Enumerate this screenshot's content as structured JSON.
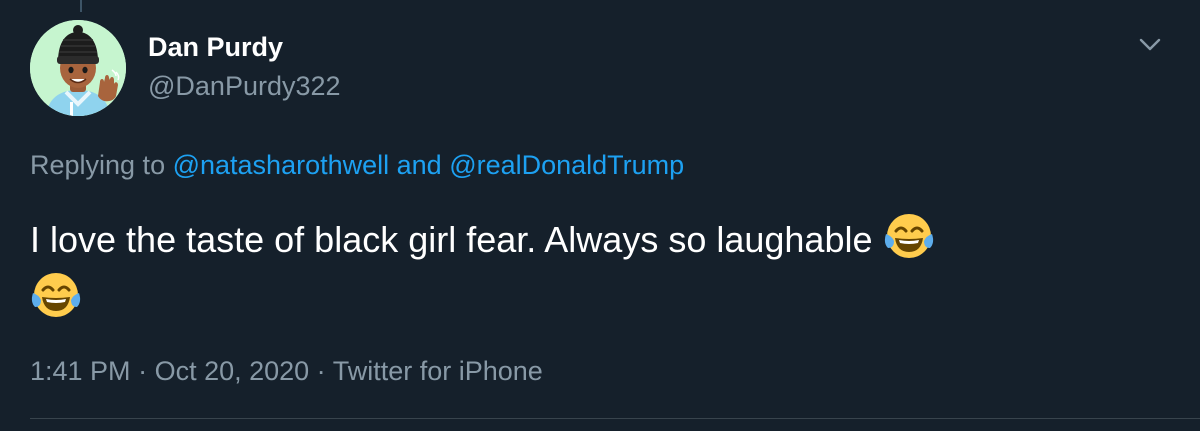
{
  "author": {
    "name": "Dan Purdy",
    "handle": "@DanPurdy322"
  },
  "reply": {
    "prefix": "Replying to ",
    "mention_1": "@natasharothwell",
    "connector": " and ",
    "mention_2": "@realDonaldTrump"
  },
  "tweet": {
    "text": "I love the taste of black girl fear. Always so laughable ",
    "emojis": [
      "face-with-tears-of-joy-emoji",
      "face-with-tears-of-joy-emoji"
    ]
  },
  "meta": {
    "time": "1:41 PM",
    "separator": " · ",
    "date": "Oct 20, 2020",
    "source": "Twitter for iPhone"
  },
  "icons": {
    "more": "chevron-down-icon",
    "avatar": "memoji-avatar"
  },
  "colors": {
    "background": "#15202b",
    "primary_text": "#ffffff",
    "secondary_text": "#8899a6",
    "link": "#1da1f2",
    "divider": "#38444d"
  }
}
